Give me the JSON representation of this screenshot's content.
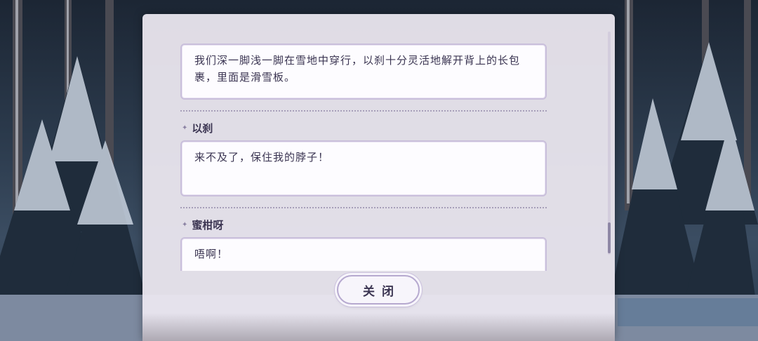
{
  "dialogue_log": {
    "entries": [
      {
        "speaker": "",
        "text": "我们深一脚浅一脚在雪地中穿行，以刹十分灵活地解开背上的长包裹，里面是滑雪板。"
      },
      {
        "speaker": "以刹",
        "text": "来不及了，保住我的脖子！"
      },
      {
        "speaker": "蜜柑呀",
        "text": "唔啊！"
      }
    ],
    "close_label": "关闭"
  }
}
